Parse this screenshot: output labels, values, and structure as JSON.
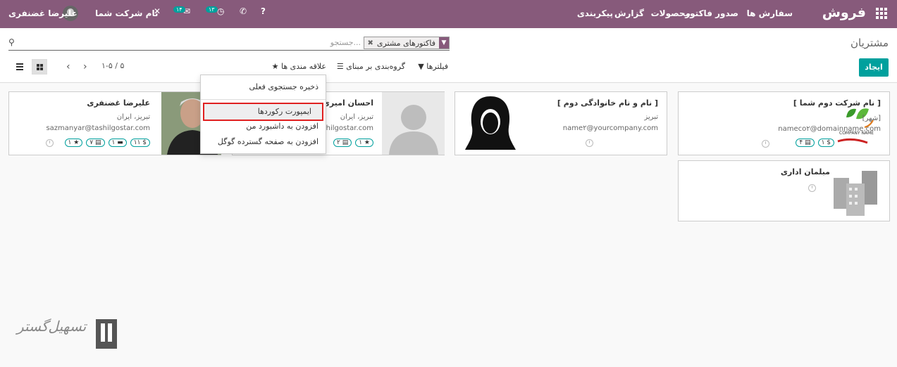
{
  "header": {
    "brand": "فروش",
    "menu": [
      "سفارش ها",
      "صدور فاکتور",
      "محصولات",
      "گزارش",
      "پیکربندی"
    ],
    "company": "نام شرکت شما",
    "user": "علیرضا غضنفری",
    "activity_badge": "۱۳",
    "messages_badge": "۱۴"
  },
  "control_panel": {
    "breadcrumb": "مشتریان",
    "facet_label": "فاکتورهای مشتری",
    "search_placeholder": "جستجو...",
    "create": "ایجاد",
    "filters": "فیلترها",
    "group_by": "گروه‌بندی بر مبنای",
    "favorites": "علاقه مندی ها",
    "pager": "۱-۵ / ۵"
  },
  "favorites_menu": {
    "items": [
      "ذخیره جستجوی فعلی",
      "ایمپورت رکوردها",
      "افزودن به داشبورد من",
      "افزودن به صفحه گسترده گوگل"
    ],
    "highlighted": "ایمپورت رکوردها"
  },
  "cards": [
    {
      "name": "[ نام شرکت دوم شما ]",
      "lines": [
        "[شهر]",
        "nameco۲@domainname.com"
      ],
      "tags": [
        "۴",
        "۱ $"
      ],
      "logo_text": "COMPANY NAME"
    },
    {
      "name": "[ نام و نام خانوادگی دوم ]",
      "lines": [
        "تبریز",
        "name۲@yourcompany.com"
      ],
      "tags": []
    },
    {
      "name": "احسان امیری",
      "lines": [
        "تبریز، ایران",
        "shilgostar.com"
      ],
      "tags": [
        "۲",
        "۱"
      ]
    },
    {
      "name": "علیرضا غضنفری",
      "lines": [
        "تبریز، ایران",
        "sazmanyar@tashilgostar.com"
      ],
      "tags": [
        "۱",
        "۷",
        "۱",
        "۱۱ $"
      ]
    },
    {
      "name": "مبلمان اداری",
      "lines": [],
      "tags": []
    }
  ],
  "watermark": "تسهیل‌گستر",
  "colors": {
    "primary": "#875a7b",
    "accent": "#00a09d",
    "highlight": "#e02020"
  }
}
